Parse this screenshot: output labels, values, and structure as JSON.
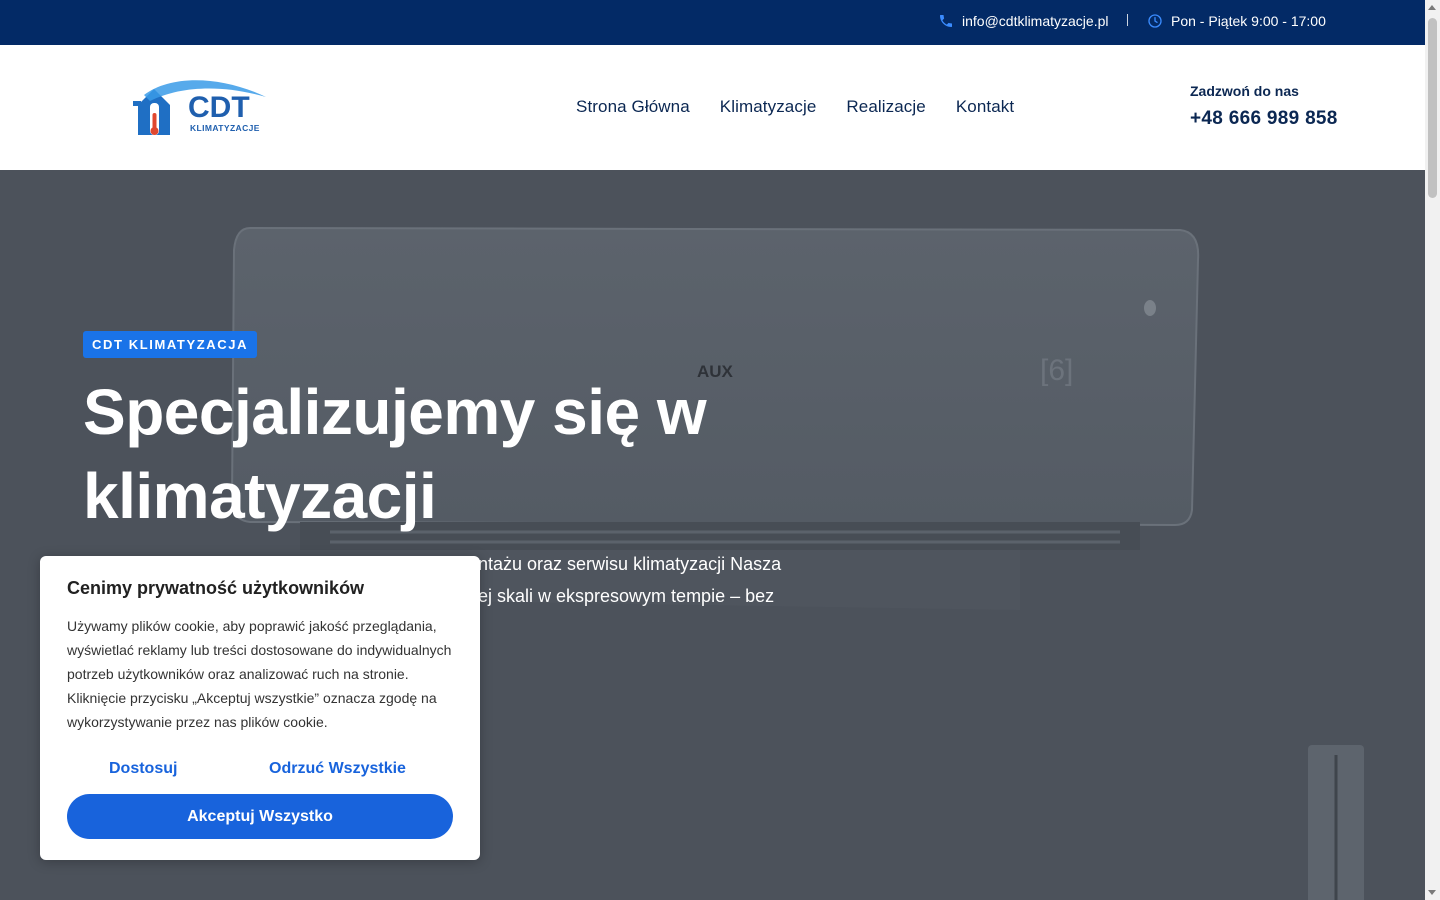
{
  "topbar": {
    "email": "info@cdtklimatyzacje.pl",
    "hours": "Pon - Piątek 9:00 - 17:00",
    "separator": "|"
  },
  "logo": {
    "brand": "CDT",
    "sub": "KLIMATYZACJE"
  },
  "nav": {
    "items": [
      {
        "label": "Strona Główna"
      },
      {
        "label": "Klimatyzacje"
      },
      {
        "label": "Realizacje"
      },
      {
        "label": "Kontakt"
      }
    ]
  },
  "call": {
    "label": "Zadzwoń do nas",
    "number": "+48 666 989 858"
  },
  "hero": {
    "badge": "CDT KLIMATYZACJA",
    "title": "Specjalizujemy się w klimatyzacji",
    "text_visible_line1": "ntażu oraz serwisu klimatyzacji Nasza",
    "text_visible_line2": "ej skali w ekspresowym tempie – bez",
    "ac_brand": "AUX"
  },
  "cookie": {
    "title": "Cenimy prywatność użytkowników",
    "text": "Używamy plików cookie, aby poprawić jakość przeglądania, wyświetlać reklamy lub treści dostosowane do indywidualnych potrzeb użytkowników oraz analizować ruch na stronie. Kliknięcie przycisku „Akceptuj wszystkie” oznacza zgodę na wykorzystywanie przez nas plików cookie.",
    "customize": "Dostosuj",
    "reject": "Odrzuć Wszystkie",
    "accept": "Akceptuj Wszystko"
  },
  "colors": {
    "topbar": "#032a66",
    "navText": "#0b2752",
    "accent": "#1a73e8",
    "cookieButton": "#1863dc"
  },
  "icons": {
    "email": "phone-icon",
    "hours": "clock-icon"
  }
}
